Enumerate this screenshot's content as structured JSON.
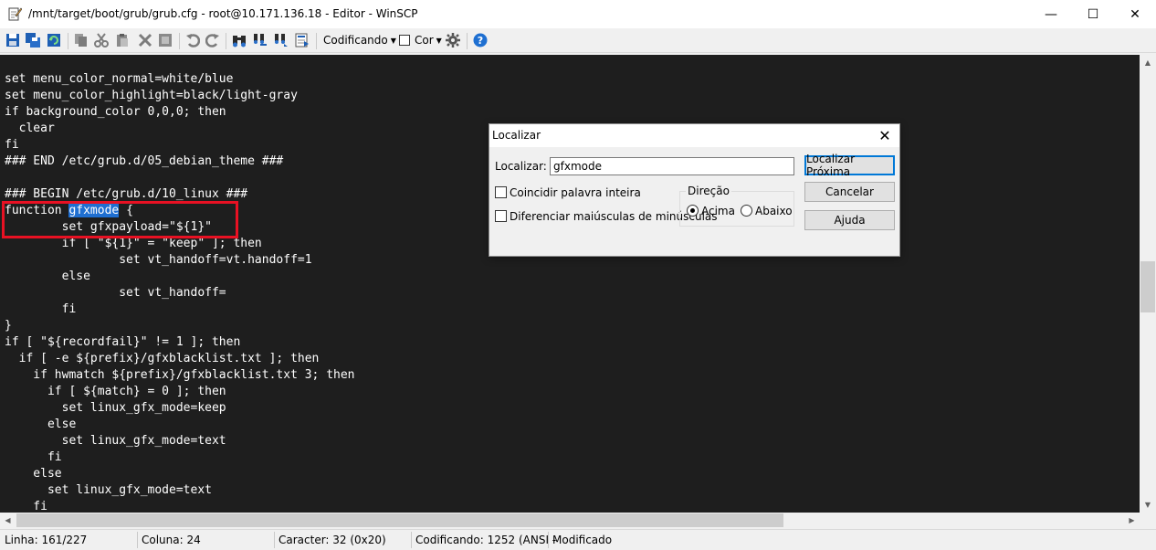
{
  "window": {
    "title": "/mnt/target/boot/grub/grub.cfg - root@10.171.136.18 - Editor - WinSCP",
    "minimize_glyph": "—",
    "maximize_glyph": "☐",
    "close_glyph": "✕"
  },
  "toolbar": {
    "encoding_label": "Codificando",
    "color_label": "Cor",
    "icons": [
      "save-icon",
      "save-all-icon",
      "reload-icon",
      "copy-icon",
      "cut-icon",
      "copy2-icon",
      "delete-icon",
      "select-all-icon",
      "undo-icon",
      "redo-icon",
      "find-icon",
      "replace-icon",
      "find-next-icon",
      "goto-line-icon",
      "settings-gear-icon",
      "help-icon"
    ]
  },
  "editor": {
    "lines": [
      "set menu_color_normal=white/blue",
      "set menu_color_highlight=black/light-gray",
      "if background_color 0,0,0; then",
      "  clear",
      "fi",
      "### END /etc/grub.d/05_debian_theme ###",
      "",
      "### BEGIN /etc/grub.d/10_linux ###",
      "function ",
      "        set gfxpayload=\"${1}\"",
      "        if [ \"${1}\" = \"keep\" ]; then",
      "                set vt_handoff=vt.handoff=1",
      "        else",
      "                set vt_handoff=",
      "        fi",
      "}",
      "if [ \"${recordfail}\" != 1 ]; then",
      "  if [ -e ${prefix}/gfxblacklist.txt ]; then",
      "    if hwmatch ${prefix}/gfxblacklist.txt 3; then",
      "      if [ ${match} = 0 ]; then",
      "        set linux_gfx_mode=keep",
      "      else",
      "        set linux_gfx_mode=text",
      "      fi",
      "    else",
      "      set linux_gfx_mode=text",
      "    fi"
    ],
    "highlighted_word": "gfxmode",
    "after_highlight": " {"
  },
  "statusbar": {
    "line": "Linha: 161/227",
    "column": "Coluna: 24",
    "character": "Caracter: 32 (0x20)",
    "encoding": "Codificando: 1252  (ANSI -",
    "state": "Modificado"
  },
  "find_dialog": {
    "title": "Localizar",
    "find_label": "Localizar:",
    "find_value": "gfxmode",
    "whole_word_label": "Coincidir palavra inteira",
    "match_case_label": "Diferenciar maiúsculas de minúsculas",
    "direction_label": "Direção",
    "up_label": "Acima",
    "down_label": "Abaixo",
    "find_next_button": "Localizar Próxima",
    "cancel_button": "Cancelar",
    "help_button": "Ajuda"
  }
}
